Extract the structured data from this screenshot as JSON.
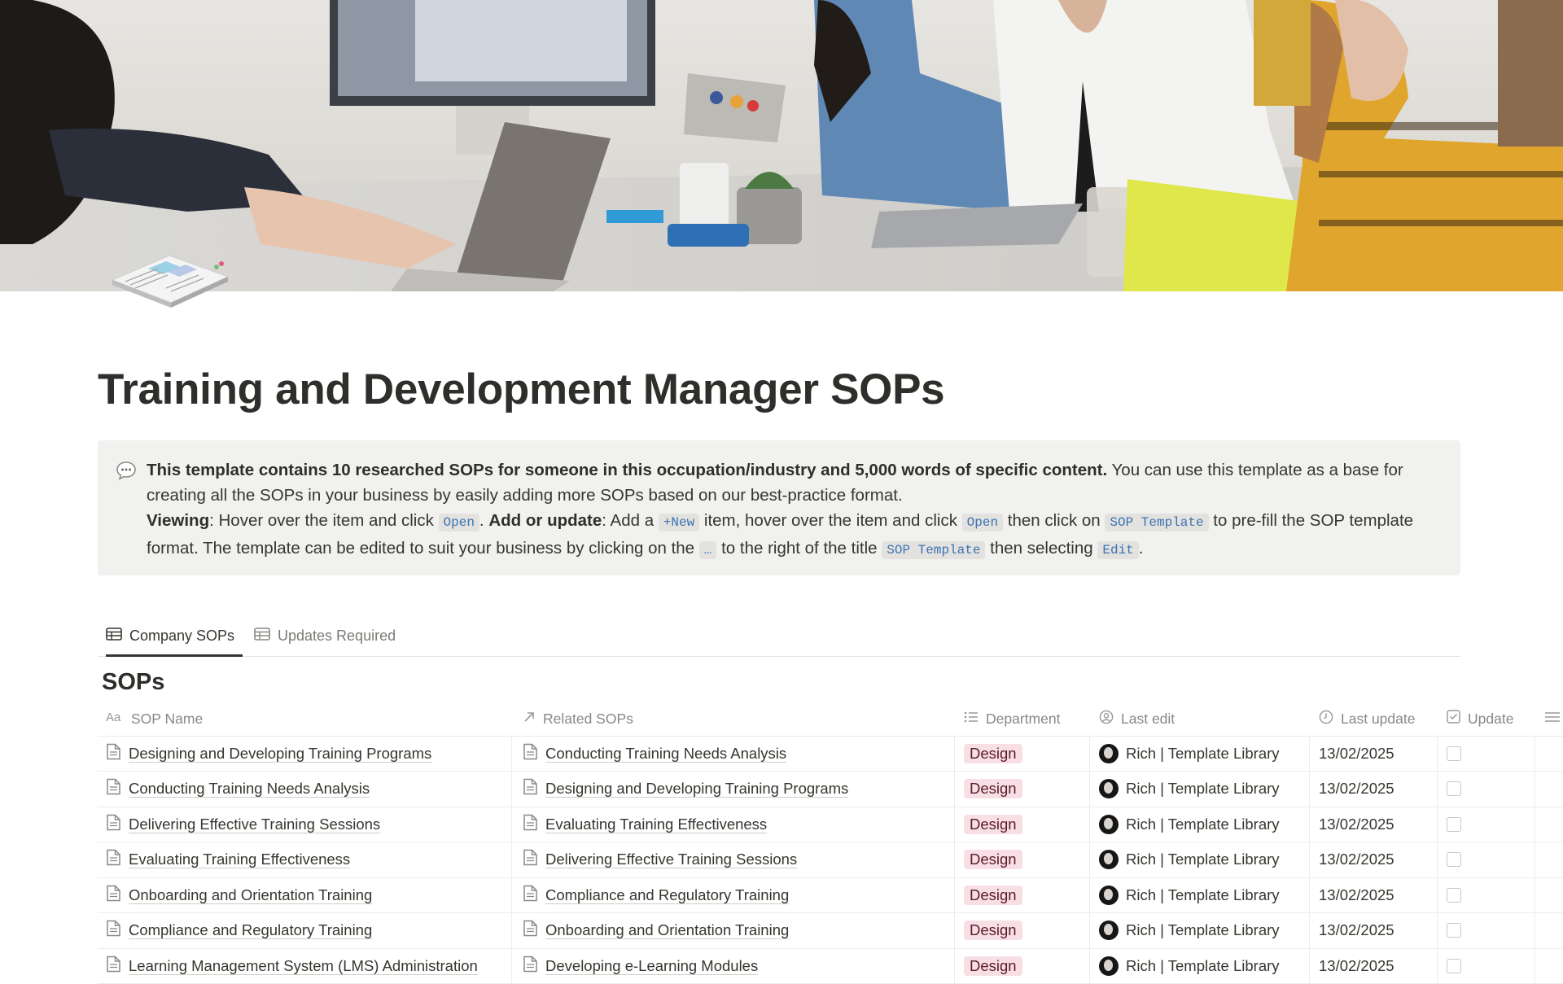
{
  "page": {
    "title": "Training and Development Manager SOPs"
  },
  "cover": {
    "icon": "photo-cover",
    "page_icon": "paper-stack-icon"
  },
  "callout": {
    "icon": "speech-bubble-icon",
    "bold_intro": "This template contains 10 researched SOPs for someone in this occupation/industry and 5,000 words of specific content.",
    "intro_rest": " You can use this template as a base for creating all the SOPs in your business by easily adding more SOPs based on our best-practice format.",
    "viewing_label": "Viewing",
    "viewing_text": ": Hover over the item and click ",
    "code_open": "Open",
    "sep": ". ",
    "add_label": "Add or update",
    "add_text_1": ": Add a ",
    "code_new": "+New",
    "add_text_2": " item, hover over the item and click ",
    "code_open_2": "Open",
    "add_text_3": " then click on ",
    "code_sop_template": "SOP Template",
    "add_text_4": " to pre-fill the SOP template format. The template can be edited to suit your business by clicking on the ",
    "code_dots": "…",
    "add_text_5": " to the right of the title ",
    "code_sop_template_2": "SOP Template",
    "add_text_6": " then selecting ",
    "code_edit": "Edit",
    "end": "."
  },
  "tabs": [
    {
      "label": "Company SOPs",
      "icon": "table-icon",
      "active": true
    },
    {
      "label": "Updates Required",
      "icon": "table-icon",
      "active": false
    }
  ],
  "database": {
    "title": "SOPs",
    "columns": [
      {
        "label": "SOP Name",
        "icon": "text-type-icon"
      },
      {
        "label": "Related SOPs",
        "icon": "relation-arrow-icon"
      },
      {
        "label": "Department",
        "icon": "list-icon"
      },
      {
        "label": "Last edit",
        "icon": "person-icon"
      },
      {
        "label": "Last update",
        "icon": "clock-icon"
      },
      {
        "label": "Update",
        "icon": "checkbox-icon"
      },
      {
        "label": "",
        "icon": "more-columns-icon"
      }
    ],
    "rows": [
      {
        "name": "Designing and Developing Training Programs",
        "related": "Conducting Training Needs Analysis",
        "department": "Design",
        "last_edit": "Rich | Template Library",
        "last_update": "13/02/2025"
      },
      {
        "name": "Conducting Training Needs Analysis",
        "related": "Designing and Developing Training Programs",
        "department": "Design",
        "last_edit": "Rich | Template Library",
        "last_update": "13/02/2025"
      },
      {
        "name": "Delivering Effective Training Sessions",
        "related": "Evaluating Training Effectiveness",
        "department": "Design",
        "last_edit": "Rich | Template Library",
        "last_update": "13/02/2025"
      },
      {
        "name": "Evaluating Training Effectiveness",
        "related": "Delivering Effective Training Sessions",
        "department": "Design",
        "last_edit": "Rich | Template Library",
        "last_update": "13/02/2025"
      },
      {
        "name": "Onboarding and Orientation Training",
        "related": "Compliance and Regulatory Training",
        "department": "Design",
        "last_edit": "Rich | Template Library",
        "last_update": "13/02/2025"
      },
      {
        "name": "Compliance and Regulatory Training",
        "related": "Onboarding and Orientation Training",
        "department": "Design",
        "last_edit": "Rich | Template Library",
        "last_update": "13/02/2025"
      },
      {
        "name": "Learning Management System (LMS) Administration",
        "related": "Developing e-Learning Modules",
        "department": "Design",
        "last_edit": "Rich | Template Library",
        "last_update": "13/02/2025"
      }
    ]
  },
  "colors": {
    "tag_bg": "#f8dfe5",
    "tag_text": "#5c1a2b",
    "code_text": "#3b73b2",
    "callout_bg": "#f1f1ef"
  }
}
